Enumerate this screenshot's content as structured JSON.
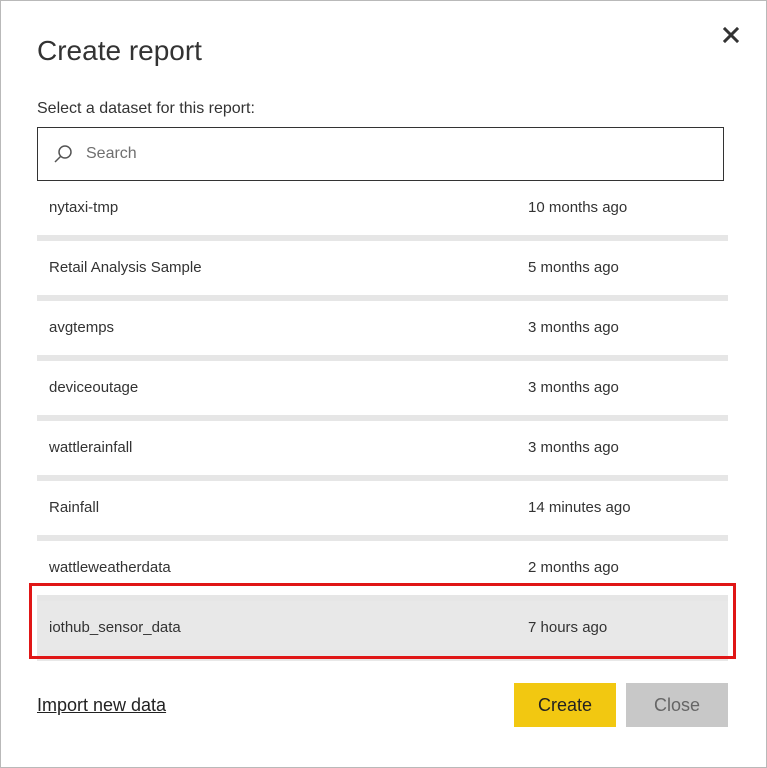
{
  "dialog": {
    "title": "Create report",
    "subtitle": "Select a dataset for this report:",
    "close_icon": "close-icon"
  },
  "search": {
    "placeholder": "Search",
    "value": "",
    "icon": "search-icon"
  },
  "datasets": [
    {
      "name": "nytaxi-tmp",
      "updated": "10 months ago"
    },
    {
      "name": "Retail Analysis Sample",
      "updated": "5 months ago"
    },
    {
      "name": "avgtemps",
      "updated": "3 months ago"
    },
    {
      "name": "deviceoutage",
      "updated": "3 months ago"
    },
    {
      "name": "wattlerainfall",
      "updated": "3 months ago"
    },
    {
      "name": "Rainfall",
      "updated": "14 minutes ago"
    },
    {
      "name": "wattleweatherdata",
      "updated": "2 months ago"
    },
    {
      "name": "iothub_sensor_data",
      "updated": "7 hours ago",
      "selected": true
    }
  ],
  "footer": {
    "import_label": "Import new data",
    "create_label": "Create",
    "close_label": "Close"
  },
  "colors": {
    "accent": "#f2c811",
    "highlight": "#e01616",
    "disabled": "#c8c8c8"
  }
}
